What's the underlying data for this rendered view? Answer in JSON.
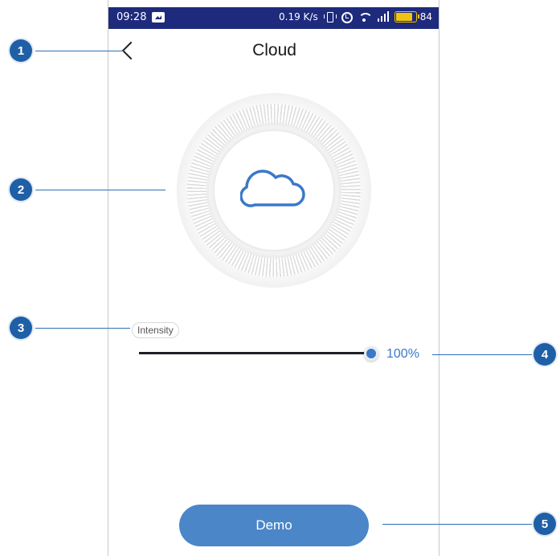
{
  "status_bar": {
    "time": "09:28",
    "network_speed": "0.19 K/s",
    "battery_level": "84",
    "battery_fraction": 0.84
  },
  "header": {
    "title": "Cloud",
    "back_icon": "chevron-left-icon"
  },
  "effect": {
    "icon": "cloud-icon"
  },
  "intensity": {
    "label": "Intensity",
    "value_text": "100%",
    "value": 1.0
  },
  "demo_button": {
    "label": "Demo"
  },
  "callouts": [
    {
      "number": "1"
    },
    {
      "number": "2"
    },
    {
      "number": "3"
    },
    {
      "number": "4"
    },
    {
      "number": "5"
    }
  ],
  "colors": {
    "status_bar": "#1e2a7c",
    "accent": "#3a78c9",
    "button": "#4a86c8",
    "callout": "#1f5fa6"
  }
}
